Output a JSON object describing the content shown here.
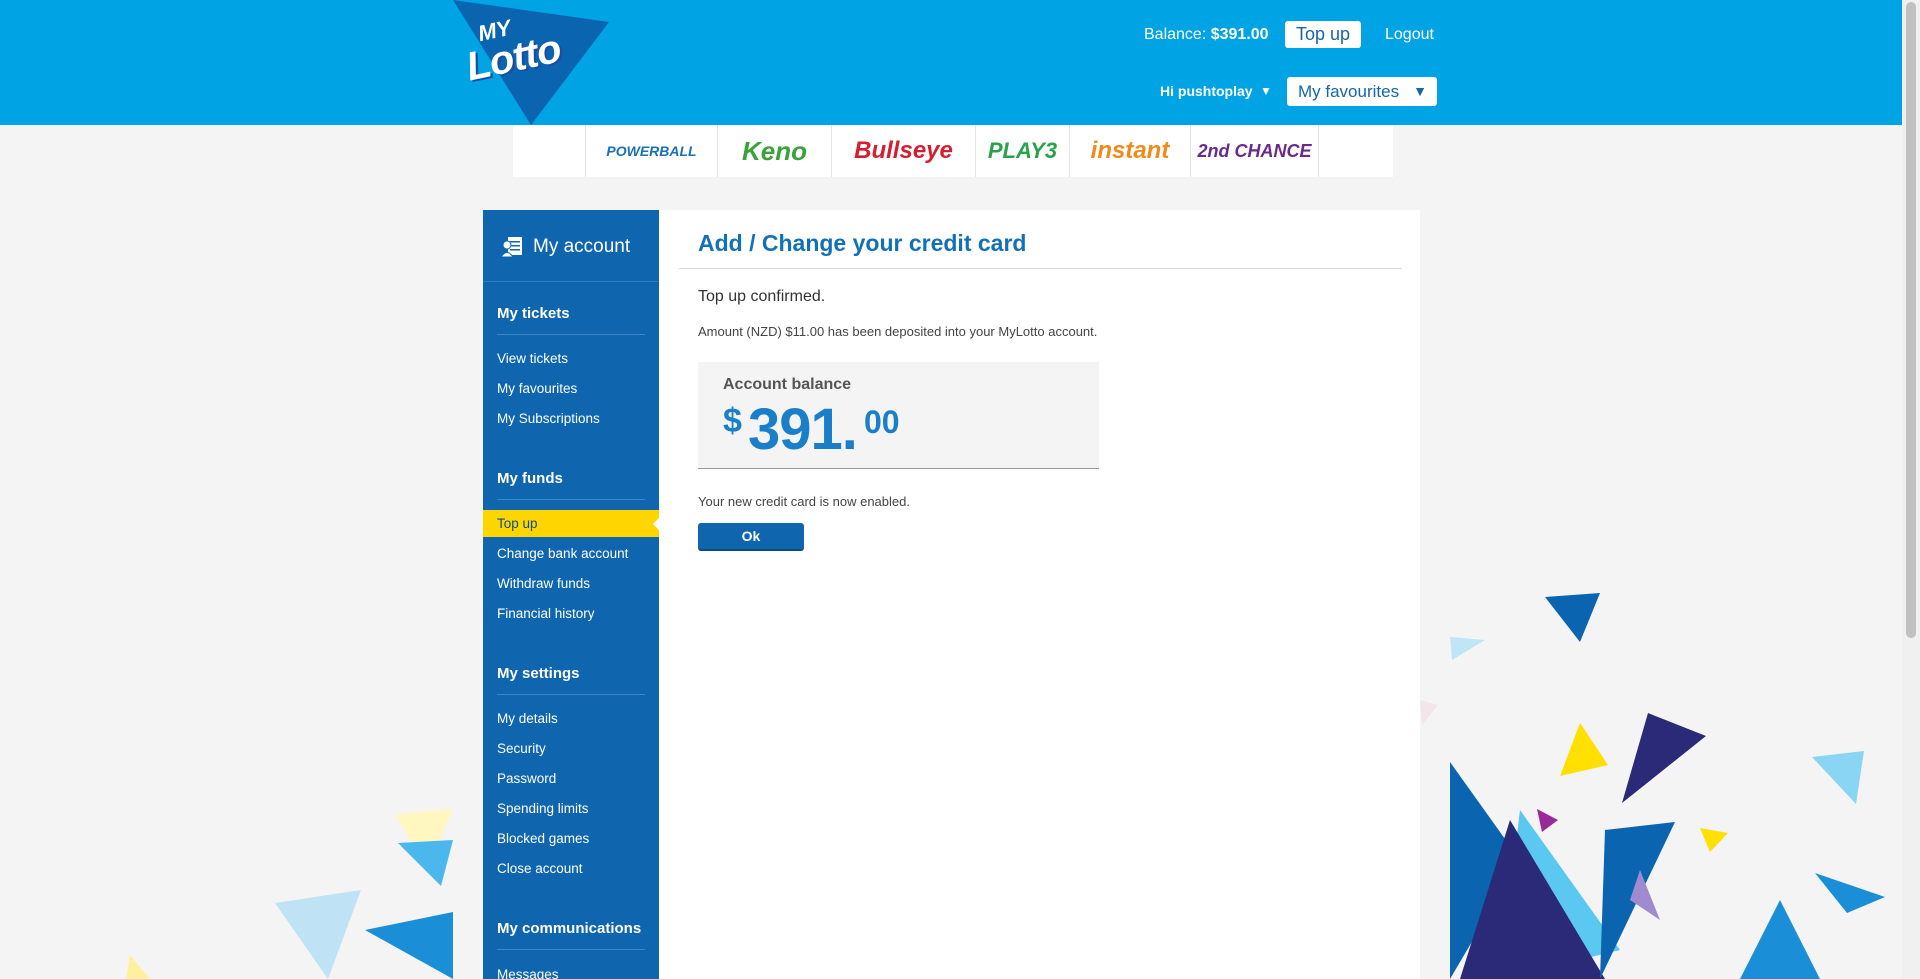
{
  "header": {
    "logo_my": "MY",
    "logo_lotto": "Lotto",
    "balance_label": "Balance:",
    "balance_value": "$391.00",
    "topup_label": "Top up",
    "logout_label": "Logout",
    "greeting": "Hi pushtoplay",
    "favourites_label": "My favourites"
  },
  "games": [
    "POWERBALL",
    "Keno",
    "Bullseye",
    "PLAY3",
    "instant",
    "2nd CHANCE"
  ],
  "sidebar": {
    "title": "My account",
    "sections": [
      {
        "label": "My tickets",
        "items": [
          "View tickets",
          "My favourites",
          "My Subscriptions"
        ]
      },
      {
        "label": "My funds",
        "items": [
          "Top up",
          "Change bank account",
          "Withdraw funds",
          "Financial history"
        ]
      },
      {
        "label": "My settings",
        "items": [
          "My details",
          "Security",
          "Password",
          "Spending limits",
          "Blocked games",
          "Close account"
        ]
      },
      {
        "label": "My communications",
        "items": [
          "Messages"
        ]
      }
    ],
    "active_item": "Top up"
  },
  "content": {
    "title": "Add / Change your credit card",
    "confirm": "Top up confirmed.",
    "amount_message": "Amount (NZD) $11.00 has been deposited into your MyLotto account.",
    "balance_label": "Account balance",
    "balance_currency": "$",
    "balance_whole": "391.",
    "balance_cents": "00",
    "card_message": "Your new credit card is now enabled.",
    "ok_label": "Ok"
  },
  "colors": {
    "header_blue": "#00a3e4",
    "sidebar_blue": "#0f66ae",
    "active_yellow": "#ffd500",
    "title_blue": "#1270b8"
  }
}
